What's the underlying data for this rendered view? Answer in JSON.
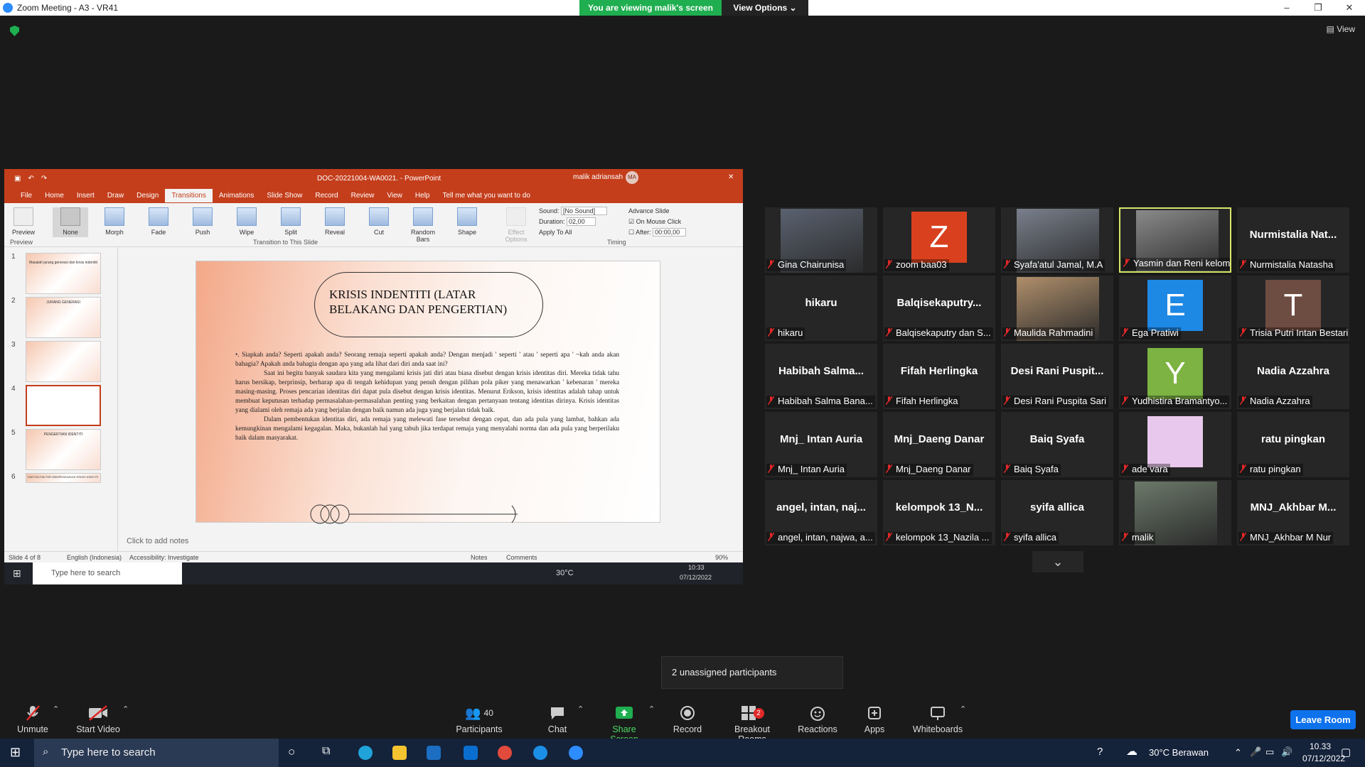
{
  "window": {
    "title": "Zoom Meeting - A3 - VR41",
    "minimize": "–",
    "maximize": "❐",
    "close": "✕"
  },
  "banner": {
    "viewing": "You are viewing malik's screen",
    "view_options": "View Options ⌄"
  },
  "view_button": "View",
  "powerpoint": {
    "doc_title": "DOC-20221004-WA0021. - PowerPoint",
    "user": "malik adriansah",
    "user_initials": "MA",
    "tabs": [
      "File",
      "Home",
      "Insert",
      "Draw",
      "Design",
      "Transitions",
      "Animations",
      "Slide Show",
      "Record",
      "Review",
      "View",
      "Help",
      "Tell me what you want to do"
    ],
    "transitions": [
      "None",
      "Morph",
      "Fade",
      "Push",
      "Wipe",
      "Split",
      "Reveal",
      "Cut",
      "Random Bars",
      "Shape"
    ],
    "preview": "Preview",
    "effect_options": "Effect Options",
    "group_transition": "Transition to This Slide",
    "group_timing": "Timing",
    "sound_label": "Sound:",
    "sound_value": "[No Sound]",
    "duration_label": "Duration:",
    "duration_value": "02,00",
    "apply_all": "Apply To All",
    "advance": "Advance Slide",
    "on_click": "On Mouse Click",
    "after_label": "After:",
    "after_value": "00:00,00",
    "thumb_numbers": [
      "1",
      "2",
      "3",
      "4",
      "5",
      "6"
    ],
    "thumb_texts": [
      "Masalah jurang generasi dan krisis indentiti",
      "JURANG GENERASI",
      "",
      "",
      "PENGERTIAN IDENTITI",
      "FAKTOR-FAKTOR MEMPENGARUHI KRISIS IDENTITI"
    ],
    "slide_title": "KRISIS INDENTITI (LATAR BELAKANG DAN PENGERTIAN)",
    "slide_body_1": "•. Siapkah anda? Seperti apakah anda? Seorang remaja seperti apakah anda? Dengan menjadi ' seperti ' atau ' seperti apa ' ~kah anda akan bahagia? Apakah anda bahagia dengan apa yang ada lihat dari diri anda saat ini?",
    "slide_body_2": "Saat ini begitu banyak saudara kita yang mengalami krisis jati diri atau biasa disebut dengan krisis identitas diri. Mereka tidak tahu harus bersikap, berprinsip, berharap apa di tengah kehidupan yang penuh dengan pilihan pola piker yang menawarkan ' kebenaran ' mereka masing-masing. Proses pencarian identitas diri dapat pula disebut dengan krisis identitas. Menurut Erikson, krisis identitas adalah tahap untuk membuat keputusan terhadap permasalahan-permasalahan penting yang berkaitan dengan pertanyaan tentang identitas dirinya. Krisis identitas yang dialami oleh remaja ada yang berjalan dengan baik namun ada juga yang berjalan tidak baik.",
    "slide_body_3": "Dalam pembentukan identitas diri, ada remaja yang melewati fase tersebut dengan cepat, dan ada pula yang lambat, bahkan ada kemungkinan mengalami kegagalan. Maka, bukanlah hal yang tabuh jika terdapat remaja yang menyalahi norma dan ada pula yang berperilaku baik dalam masyarakat.",
    "notes_placeholder": "Click to add notes",
    "status_slide": "Slide 4 of 8",
    "status_lang": "English (Indonesia)",
    "status_access": "Accessibility: Investigate",
    "status_notes": "Notes",
    "status_comments": "Comments",
    "status_zoom": "90%",
    "inner_search": "Type here to search",
    "inner_weather": "30°C",
    "inner_time": "10:33",
    "inner_date": "07/12/2022"
  },
  "participants": [
    {
      "name": "Gina Chairunisa",
      "big": ""
    },
    {
      "name": "zoom baa03",
      "big": "Z",
      "color": "#d9411e"
    },
    {
      "name": "Syafa'atul Jamal, M.A",
      "big": ""
    },
    {
      "name": "Yasmin dan Reni kelomp...",
      "big": "",
      "speaking": true
    },
    {
      "name": "Nurmistalia Natasha",
      "big": "Nurmistalia Nat..."
    },
    {
      "name": "hikaru",
      "big": "hikaru"
    },
    {
      "name": "Balqisekaputry dan S...",
      "big": "Balqisekaputry..."
    },
    {
      "name": "Maulida Rahmadini",
      "big": ""
    },
    {
      "name": "Ega Pratiwi",
      "big": "E",
      "color": "#1e88e5"
    },
    {
      "name": "Trisia Putri Intan Bestari",
      "big": "T",
      "color": "#6d4c41"
    },
    {
      "name": "Habibah Salma Bana...",
      "big": "Habibah Salma..."
    },
    {
      "name": "Fifah Herlingka",
      "big": "Fifah Herlingka"
    },
    {
      "name": "Desi Rani Puspita Sari",
      "big": "Desi Rani Puspit..."
    },
    {
      "name": "Yudhistira Bramantyo...",
      "big": "Y",
      "color": "#7cb342"
    },
    {
      "name": "Nadia Azzahra",
      "big": "Nadia Azzahra"
    },
    {
      "name": "Mnj_ Intan Auria",
      "big": "Mnj_ Intan Auria"
    },
    {
      "name": "Mnj_Daeng Danar",
      "big": "Mnj_Daeng Danar"
    },
    {
      "name": "Baiq Syafa",
      "big": "Baiq Syafa"
    },
    {
      "name": "ade vara",
      "big": "",
      "color": "#e8c8ec"
    },
    {
      "name": "ratu pingkan",
      "big": "ratu pingkan"
    },
    {
      "name": "angel, intan, najwa, a...",
      "big": "angel, intan, naj..."
    },
    {
      "name": "kelompok 13_Nazila ...",
      "big": "kelompok 13_N..."
    },
    {
      "name": "syifa allica",
      "big": "syifa allica"
    },
    {
      "name": "malik",
      "big": ""
    },
    {
      "name": "MNJ_Akhbar M Nur",
      "big": "MNJ_Akhbar M..."
    }
  ],
  "tooltip": "2 unassigned participants",
  "toolbar": {
    "unmute": "Unmute",
    "start_video": "Start Video",
    "participants": "Participants",
    "participants_count": "40",
    "chat": "Chat",
    "share_screen": "Share Screen",
    "record": "Record",
    "breakout": "Breakout Rooms",
    "breakout_badge": "2",
    "reactions": "Reactions",
    "apps": "Apps",
    "whiteboards": "Whiteboards",
    "leave": "Leave Room"
  },
  "taskbar": {
    "search": "Type here to search",
    "weather": "30°C  Berawan",
    "time": "10.33",
    "date": "07/12/2022"
  }
}
